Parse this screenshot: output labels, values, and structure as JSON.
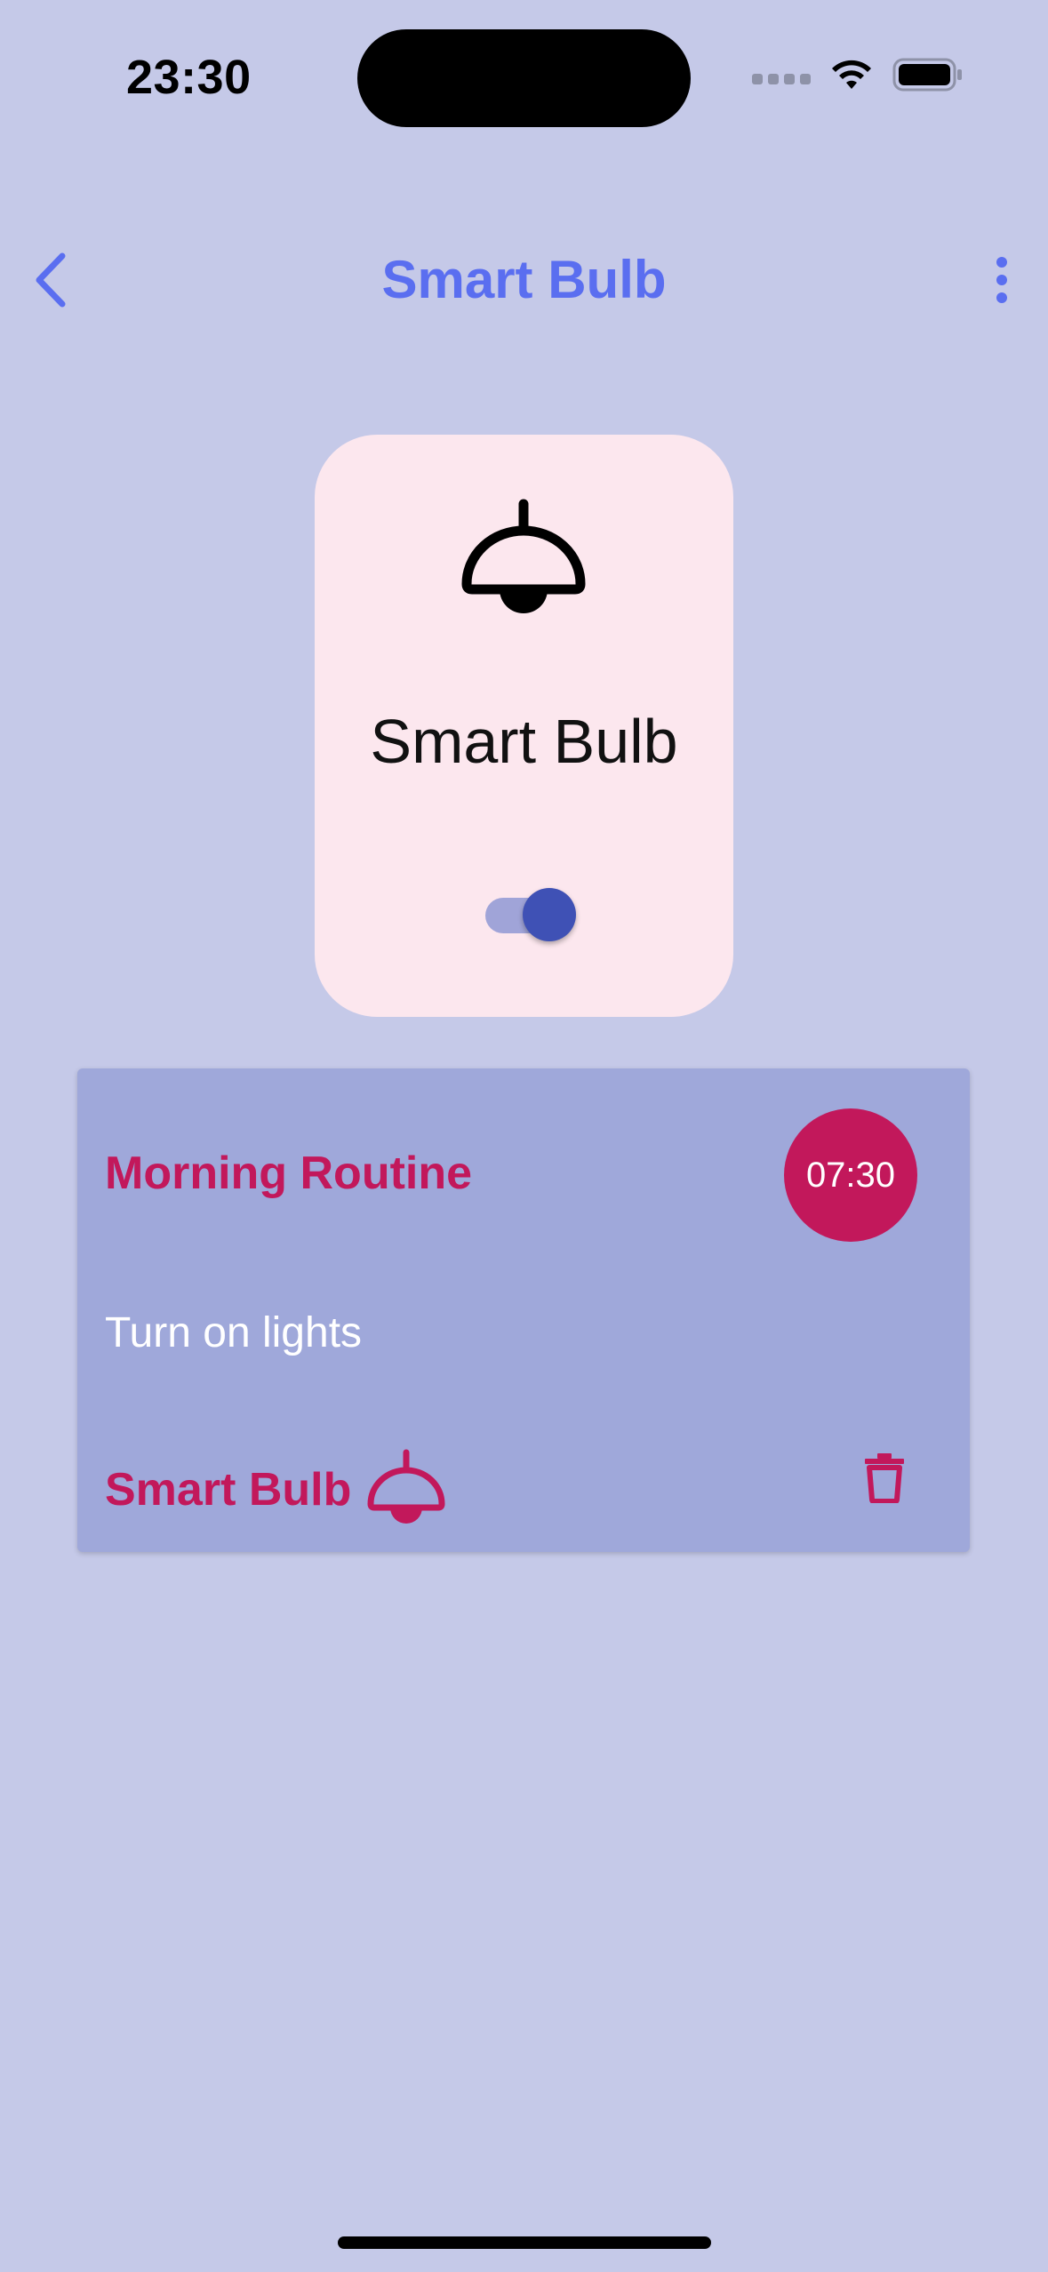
{
  "status_bar": {
    "time": "23:30"
  },
  "nav": {
    "title": "Smart Bulb",
    "back_icon": "chevron-left-icon",
    "more_icon": "more-vertical-icon"
  },
  "device": {
    "name": "Smart Bulb",
    "icon": "lamp-icon",
    "power_on": true
  },
  "routine": {
    "title": "Morning Routine",
    "time": "07:30",
    "action": "Turn on lights",
    "device_label": "Smart Bulb",
    "device_icon": "lamp-icon",
    "delete_icon": "trash-icon"
  },
  "colors": {
    "background": "#c5c9e8",
    "accent": "#5a6ef0",
    "card": "#fce7ee",
    "routine_card": "#9fa8da",
    "routine_accent": "#c2185b",
    "toggle_on": "#3f51b5"
  }
}
